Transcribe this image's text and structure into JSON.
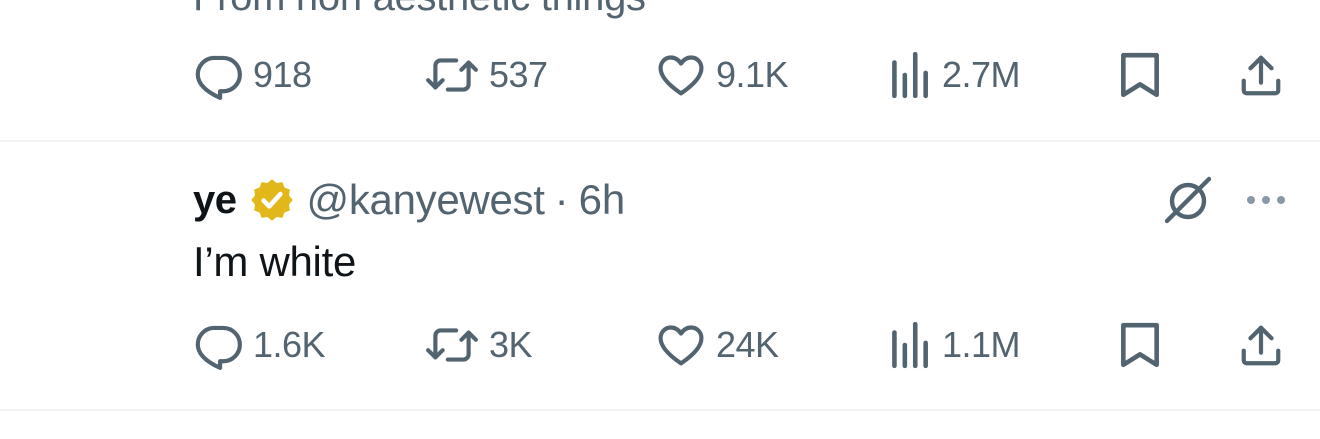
{
  "previous_tweet": {
    "clipped_text": "From non aesthetic things",
    "replies": "918",
    "retweets": "537",
    "likes": "9.1K",
    "views": "2.7M",
    "icons": [
      "reply-icon",
      "retweet-icon",
      "like-icon",
      "views-icon",
      "bookmark-icon",
      "share-icon"
    ]
  },
  "tweet": {
    "display_name": "ye",
    "handle": "@kanyewest",
    "separator": "·",
    "time": "6h",
    "text": "I’m white",
    "replies": "1.6K",
    "retweets": "3K",
    "likes": "24K",
    "views": "1.1M",
    "icons": [
      "verified-badge-icon",
      "grok-icon",
      "more-icon",
      "reply-icon",
      "retweet-icon",
      "like-icon",
      "views-icon",
      "bookmark-icon",
      "share-icon"
    ]
  },
  "colors": {
    "text_primary": "#0f1419",
    "text_secondary": "#536471",
    "verified_gold": "#e2b719",
    "divider": "#eff3f4",
    "background": "#ffffff"
  }
}
